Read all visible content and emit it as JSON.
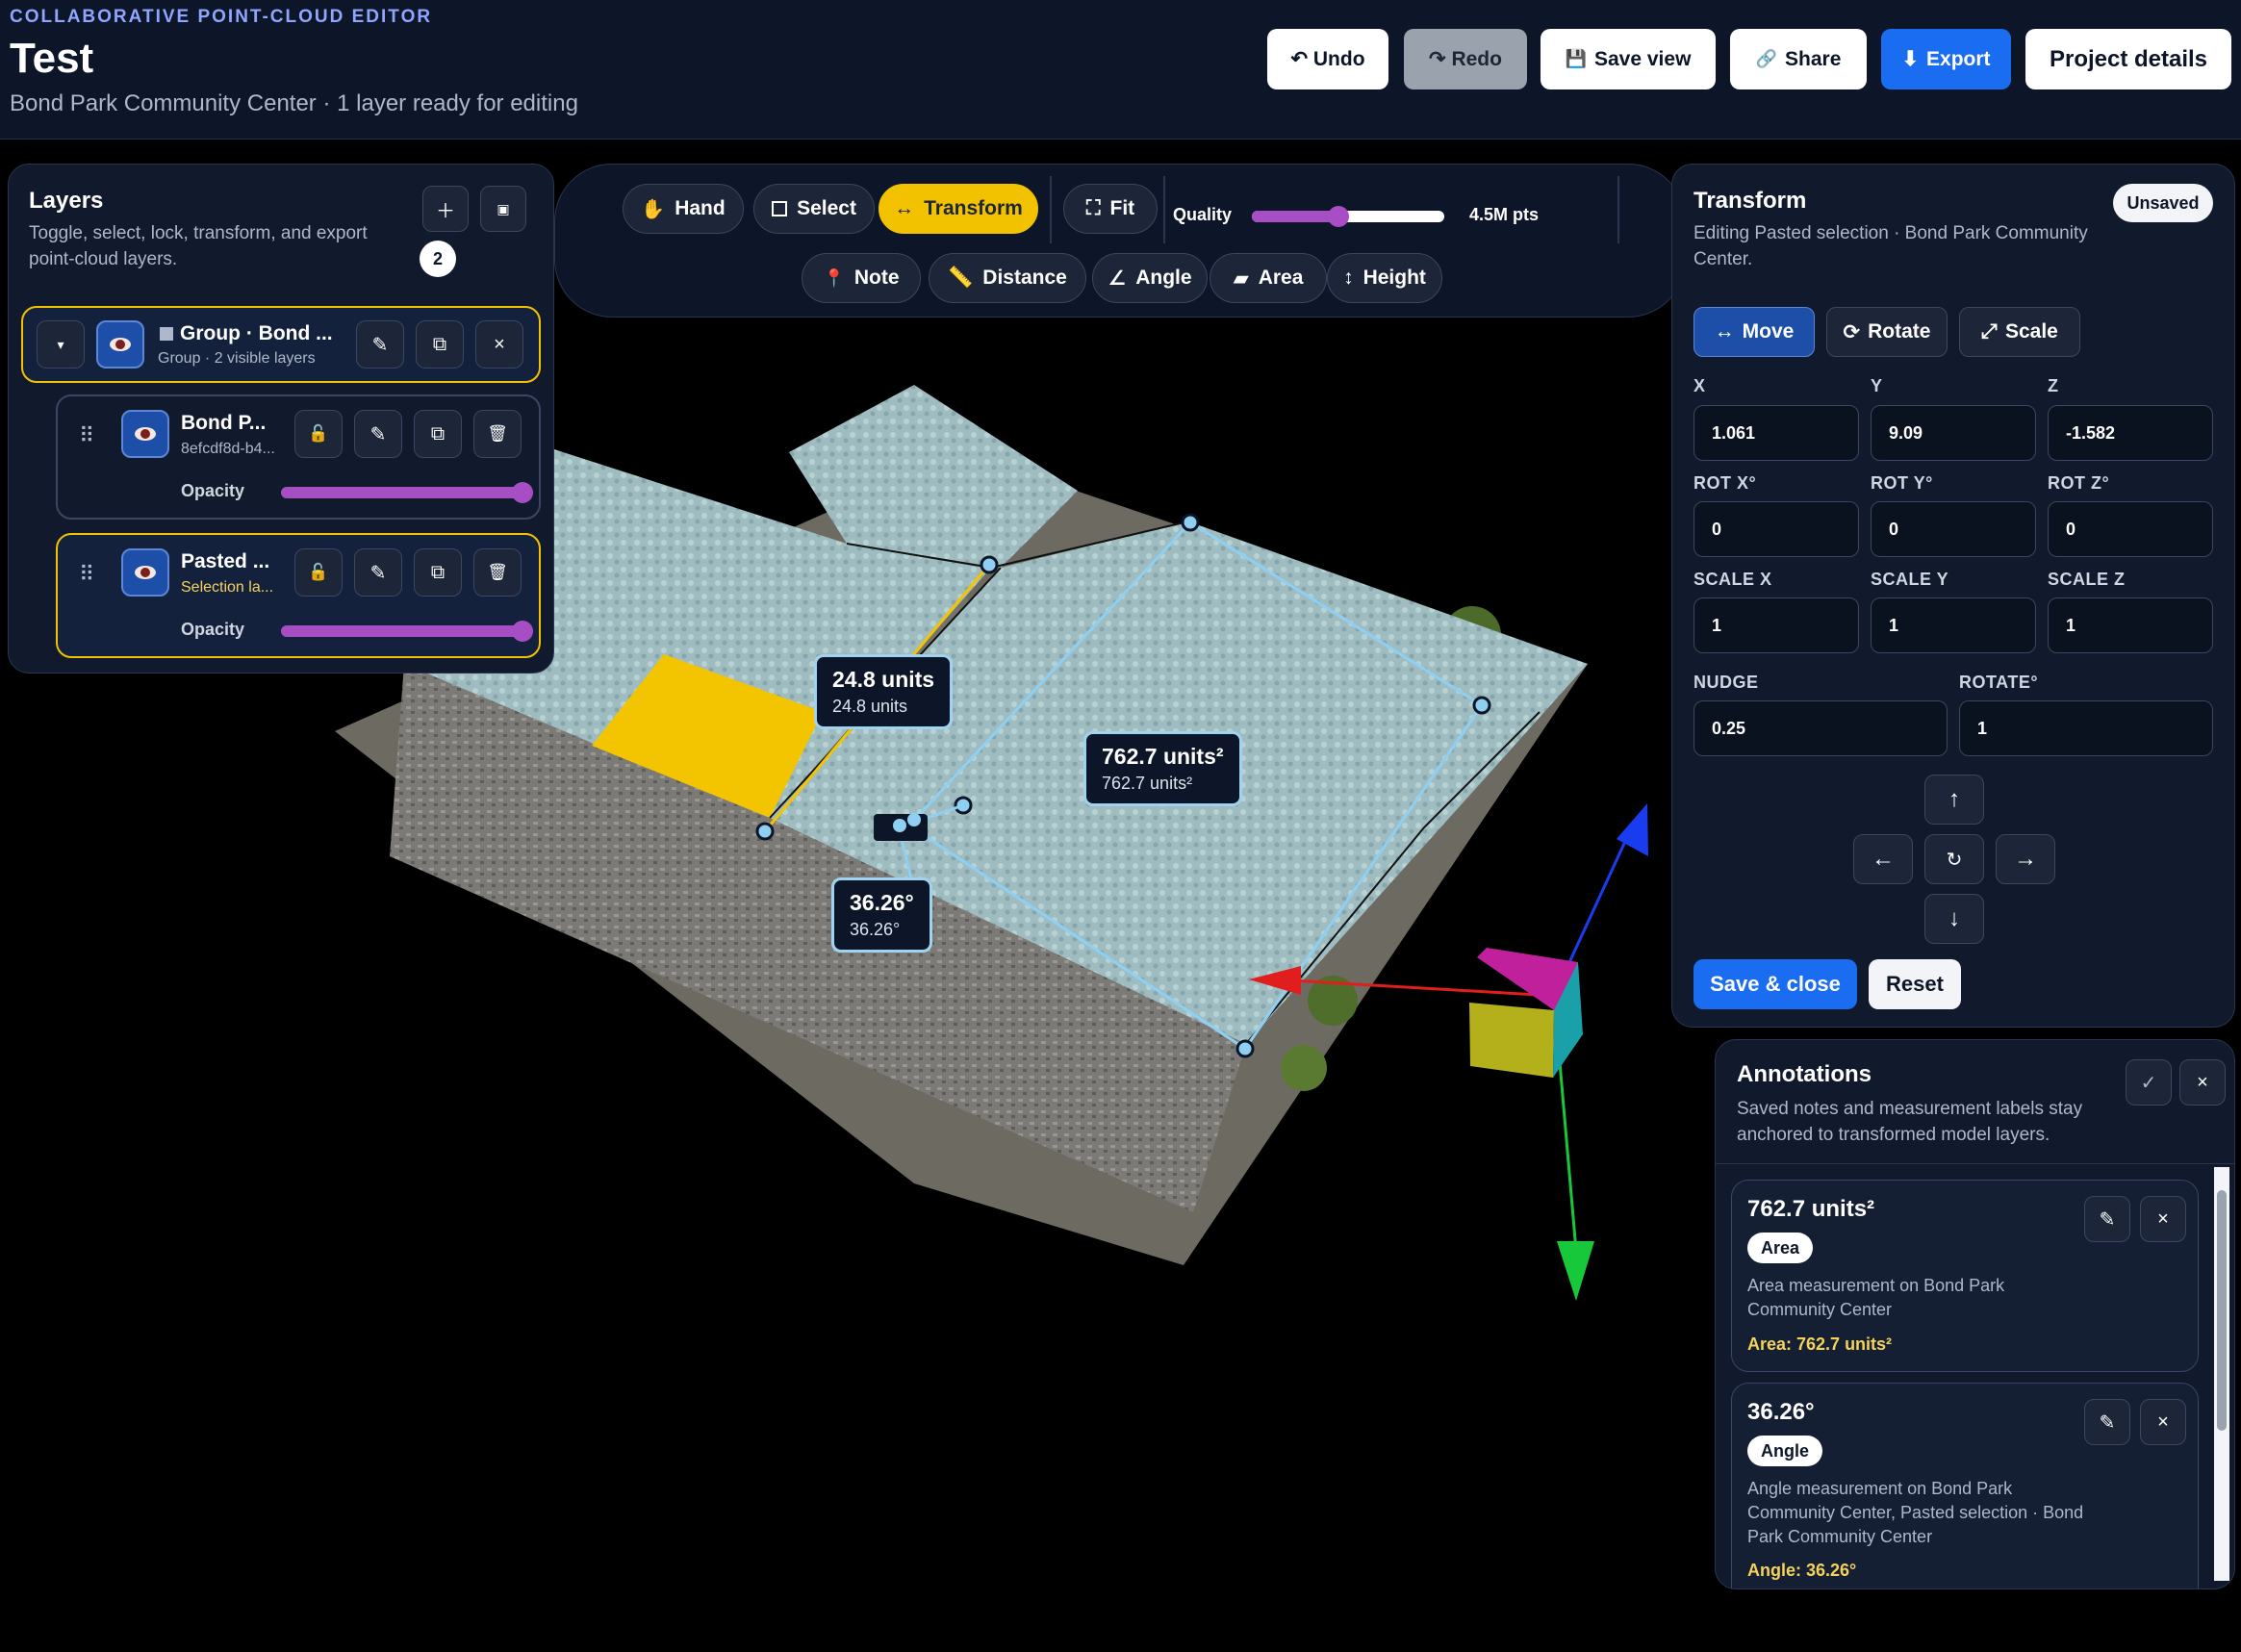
{
  "header": {
    "kicker": "COLLABORATIVE POINT-CLOUD EDITOR",
    "title": "Test",
    "subtitle": "Bond Park Community Center · 1 layer ready for editing",
    "buttons": {
      "undo": "↶ Undo",
      "redo": "↷ Redo",
      "save_view": "Save view",
      "share": "Share",
      "export": "Export",
      "project_details": "Project details"
    }
  },
  "layers_panel": {
    "title": "Layers",
    "description": "Toggle, select, lock, transform, and export point-cloud layers.",
    "count": "2",
    "group": {
      "name": "Group · Bond ...",
      "sub": "Group · 2 visible layers"
    },
    "layers": [
      {
        "name": "Bond P...",
        "sub": "8efcdf8d-b4...",
        "opacity_label": "Opacity",
        "opacity": 1.0
      },
      {
        "name": "Pasted ...",
        "sub": "Selection la...",
        "opacity_label": "Opacity",
        "opacity": 1.0
      }
    ]
  },
  "toolbar": {
    "tools": [
      "Hand",
      "Select",
      "Transform",
      "Fit"
    ],
    "active_tool": "Transform",
    "quality_label": "Quality",
    "quality_level": 0.45,
    "points_label": "4.5M pts",
    "measure_tools": [
      "Note",
      "Distance",
      "Angle",
      "Area",
      "Height"
    ]
  },
  "transform_panel": {
    "title": "Transform",
    "status_badge": "Unsaved",
    "description": "Editing Pasted selection · Bond Park Community Center.",
    "modes": [
      "Move",
      "Rotate",
      "Scale"
    ],
    "active_mode": "Move",
    "fields": {
      "x_label": "X",
      "x": "1.061",
      "y_label": "Y",
      "y": "9.09",
      "z_label": "Z",
      "z": "-1.582",
      "rotx_label": "ROT X°",
      "rotx": "0",
      "roty_label": "ROT Y°",
      "roty": "0",
      "rotz_label": "ROT Z°",
      "rotz": "0",
      "scalex_label": "SCALE X",
      "scalex": "1",
      "scaley_label": "SCALE Y",
      "scaley": "1",
      "scalez_label": "SCALE Z",
      "scalez": "1",
      "nudge_label": "NUDGE",
      "nudge": "0.25",
      "rotate_label": "ROTATE°",
      "rotate": "1"
    },
    "save_label": "Save & close",
    "reset_label": "Reset"
  },
  "annotations_panel": {
    "title": "Annotations",
    "description": "Saved notes and measurement labels stay anchored to transformed model layers.",
    "items": [
      {
        "value": "762.7 units²",
        "tag": "Area",
        "text": "Area measurement on Bond Park Community Center",
        "footer": "Area: 762.7 units²"
      },
      {
        "value": "36.26°",
        "tag": "Angle",
        "text": "Angle measurement on Bond Park Community Center, Pasted selection · Bond Park Community Center",
        "footer": "Angle: 36.26°"
      }
    ]
  },
  "viewport": {
    "labels": {
      "distance_main": "24.8 units",
      "distance_sub": "24.8 units",
      "area_main": "762.7 units²",
      "area_sub": "762.7 units²",
      "angle_main": "36.26°",
      "angle_sub": "36.26°"
    }
  },
  "colors": {
    "accent_blue": "#1a6cf0",
    "active_tool": "#f2c200",
    "slider": "#a84ec4",
    "measure_line": "#8fd0f2",
    "header_bg": "#0d1628"
  }
}
